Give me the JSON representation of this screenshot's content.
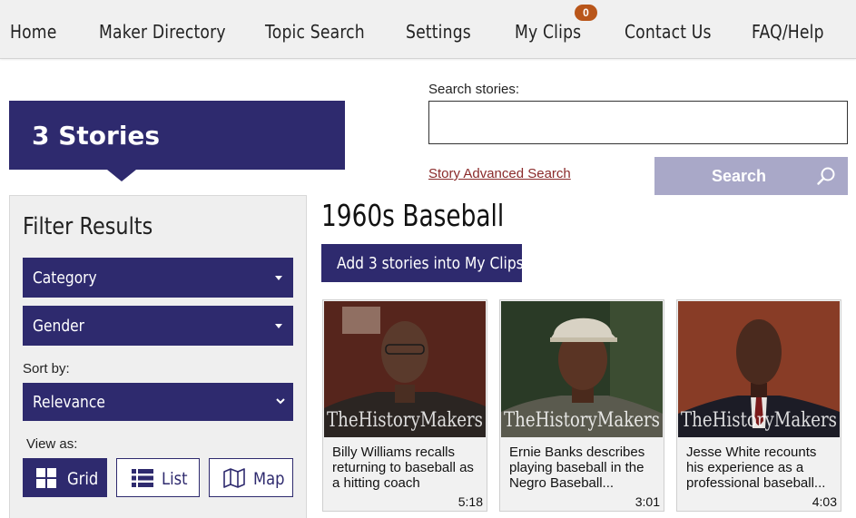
{
  "nav": {
    "items": [
      "Home",
      "Maker Directory",
      "Topic Search",
      "Settings",
      "My Clips",
      "Contact Us",
      "FAQ/Help"
    ],
    "clips_count": "0"
  },
  "results_count": "3 Stories",
  "search": {
    "label": "Search stories:",
    "value": "",
    "placeholder": "",
    "advanced_link": "Story Advanced Search",
    "button_label": "Search"
  },
  "filters": {
    "title": "Filter Results",
    "category_label": "Category",
    "gender_label": "Gender",
    "sort_label": "Sort by:",
    "sort_value": "Relevance",
    "view_label": "View as:",
    "views": [
      "Grid",
      "List",
      "Map"
    ],
    "active_view": "Grid"
  },
  "results": {
    "title": "1960s Baseball",
    "add_button": "Add 3 stories into My Clips",
    "watermark": "TheHistoryMakers",
    "stories": [
      {
        "title": "Billy Williams recalls returning to baseball as a hitting coach",
        "duration": "5:18"
      },
      {
        "title": "Ernie Banks describes playing baseball in the Negro Baseball...",
        "duration": "3:01"
      },
      {
        "title": "Jesse White recounts his experience as a professional baseball...",
        "duration": "4:03"
      }
    ]
  },
  "colors": {
    "brand": "#2e2a6e",
    "badge": "#b9561a",
    "search_button": "#a9a8c8",
    "link": "#8a2a2a"
  }
}
